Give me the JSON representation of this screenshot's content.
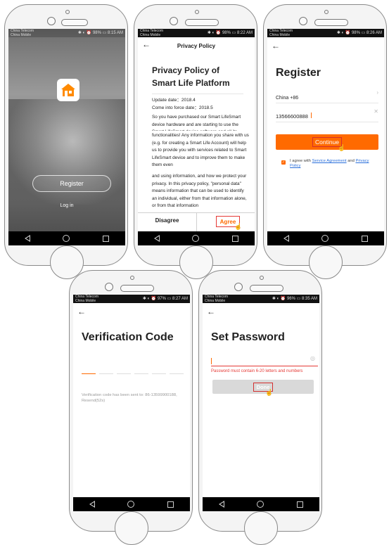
{
  "colors": {
    "accent": "#ff6a00",
    "error": "#e53935",
    "link": "#2a6fdb",
    "navbar": "#000000"
  },
  "phones": {
    "p1": {
      "status": {
        "carrier": "China Telecom\nChina Mobile",
        "right": "✱ ◐ ⏰ 98% ▭ 8:15 AM"
      },
      "register_label": "Register",
      "login_label": "Log in"
    },
    "p2": {
      "status": {
        "carrier": "China Telecom\nChina Mobile",
        "right": "✱ ◐ ⏰ 98% ▭ 8:22 AM"
      },
      "header_title": "Privacy Policy",
      "doc_title": "Privacy Policy of Smart Life Platform",
      "update_date": "Update date：2018.4",
      "force_date": "Come into force date：2018.5",
      "para1": "So you have purchased our Smart LifeSmart device hardware and are starting to use the Smart LifeSmart device software and all its",
      "para2": "functionalities! Any information you share with us (e.g. for creating a Smart Life Account) will help us to provide you with services related to Smart LifeSmart device and to improve them to make them even",
      "para3": "and using information, and how we protect your privacy. In this privacy policy, \"personal data\" means information that can be used to identify an individual, either from that information alone, or from that information",
      "disagree_label": "Disagree",
      "agree_label": "Agree"
    },
    "p3": {
      "status": {
        "carrier": "China Telecom\nChina Mobile",
        "right": "✱ ◐ ⏰ 98% ▭ 8:26 AM"
      },
      "title": "Register",
      "country": "China +86",
      "phone_value": "13566600888",
      "continue_label": "Continue",
      "agree_prefix": "I agree with",
      "service_link": "Service Agreement",
      "and_text": "and",
      "privacy_link": "Privacy Policy"
    },
    "p4": {
      "status": {
        "carrier": "China Telecom\nChina Mobile",
        "right": "✱ ◐ ⏰ 97% ▭ 8:27 AM"
      },
      "title": "Verification Code",
      "sent_text": "Verification code has been sent to: 86-13599900188,",
      "resend_text": "Resend(52s)"
    },
    "p5": {
      "status": {
        "carrier": "China Telecom\nChina Mobile",
        "right": "✱ ◐ ⏰ 96% ▭ 8:35 AM"
      },
      "title": "Set Password",
      "hint": "Password must contain 6-20 letters and numbers",
      "done_label": "Done"
    }
  }
}
